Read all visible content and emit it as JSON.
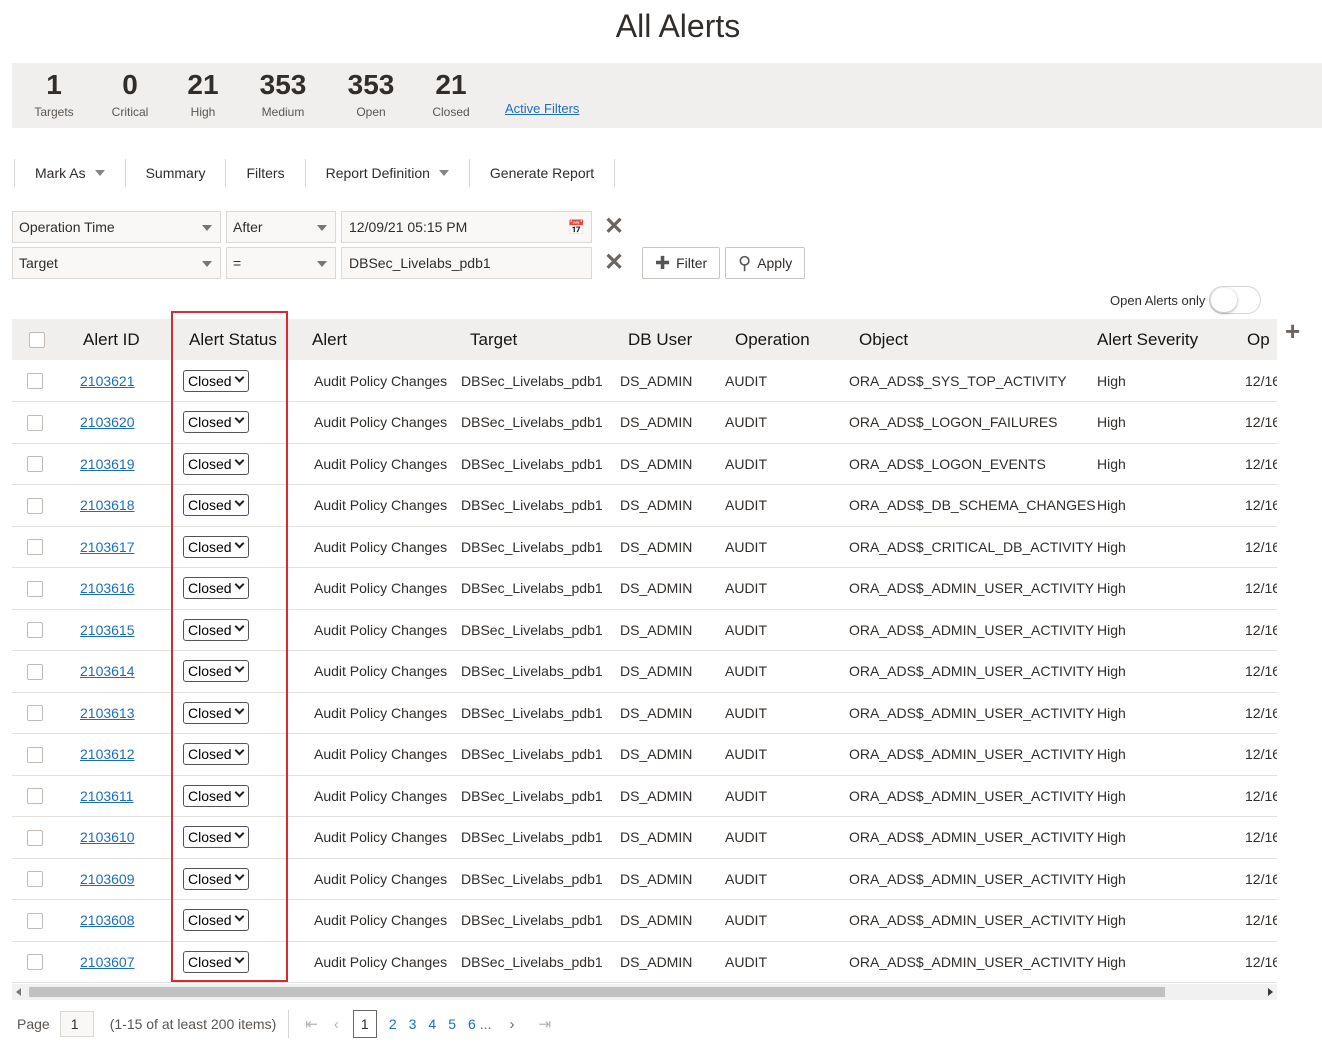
{
  "page": {
    "title": "All Alerts"
  },
  "stats": [
    {
      "value": "1",
      "label": "Targets"
    },
    {
      "value": "0",
      "label": "Critical"
    },
    {
      "value": "21",
      "label": "High"
    },
    {
      "value": "353",
      "label": "Medium"
    },
    {
      "value": "353",
      "label": "Open"
    },
    {
      "value": "21",
      "label": "Closed"
    }
  ],
  "active_filters": "Active Filters",
  "toolbar": {
    "mark_as": "Mark As",
    "summary": "Summary",
    "filters": "Filters",
    "report_definition": "Report Definition",
    "generate_report": "Generate Report"
  },
  "filters": [
    {
      "field": "Operation Time",
      "operator": "After",
      "value": "12/09/21 05:15 PM"
    },
    {
      "field": "Target",
      "operator": "=",
      "value": "DBSec_Livelabs_pdb1"
    }
  ],
  "buttons": {
    "filter": "Filter",
    "apply": "Apply"
  },
  "open_alerts_only": "Open Alerts only",
  "table": {
    "headers": [
      "Alert ID",
      "Alert Status",
      "Alert",
      "Target",
      "DB User",
      "Operation",
      "Object",
      "Alert Severity",
      "Op"
    ],
    "rows": [
      {
        "id": "2103621",
        "status": "Closed",
        "alert": "Audit Policy Changes",
        "target": "DBSec_Livelabs_pdb1",
        "db_user": "DS_ADMIN",
        "operation": "AUDIT",
        "object": "ORA_ADS$_SYS_TOP_ACTIVITY",
        "severity": "High",
        "op_time": "12/16/"
      },
      {
        "id": "2103620",
        "status": "Closed",
        "alert": "Audit Policy Changes",
        "target": "DBSec_Livelabs_pdb1",
        "db_user": "DS_ADMIN",
        "operation": "AUDIT",
        "object": "ORA_ADS$_LOGON_FAILURES",
        "severity": "High",
        "op_time": "12/16/"
      },
      {
        "id": "2103619",
        "status": "Closed",
        "alert": "Audit Policy Changes",
        "target": "DBSec_Livelabs_pdb1",
        "db_user": "DS_ADMIN",
        "operation": "AUDIT",
        "object": "ORA_ADS$_LOGON_EVENTS",
        "severity": "High",
        "op_time": "12/16/"
      },
      {
        "id": "2103618",
        "status": "Closed",
        "alert": "Audit Policy Changes",
        "target": "DBSec_Livelabs_pdb1",
        "db_user": "DS_ADMIN",
        "operation": "AUDIT",
        "object": "ORA_ADS$_DB_SCHEMA_CHANGES",
        "severity": "High",
        "op_time": "12/16/"
      },
      {
        "id": "2103617",
        "status": "Closed",
        "alert": "Audit Policy Changes",
        "target": "DBSec_Livelabs_pdb1",
        "db_user": "DS_ADMIN",
        "operation": "AUDIT",
        "object": "ORA_ADS$_CRITICAL_DB_ACTIVITY",
        "severity": "High",
        "op_time": "12/16/"
      },
      {
        "id": "2103616",
        "status": "Closed",
        "alert": "Audit Policy Changes",
        "target": "DBSec_Livelabs_pdb1",
        "db_user": "DS_ADMIN",
        "operation": "AUDIT",
        "object": "ORA_ADS$_ADMIN_USER_ACTIVITY",
        "severity": "High",
        "op_time": "12/16/"
      },
      {
        "id": "2103615",
        "status": "Closed",
        "alert": "Audit Policy Changes",
        "target": "DBSec_Livelabs_pdb1",
        "db_user": "DS_ADMIN",
        "operation": "AUDIT",
        "object": "ORA_ADS$_ADMIN_USER_ACTIVITY",
        "severity": "High",
        "op_time": "12/16/"
      },
      {
        "id": "2103614",
        "status": "Closed",
        "alert": "Audit Policy Changes",
        "target": "DBSec_Livelabs_pdb1",
        "db_user": "DS_ADMIN",
        "operation": "AUDIT",
        "object": "ORA_ADS$_ADMIN_USER_ACTIVITY",
        "severity": "High",
        "op_time": "12/16/"
      },
      {
        "id": "2103613",
        "status": "Closed",
        "alert": "Audit Policy Changes",
        "target": "DBSec_Livelabs_pdb1",
        "db_user": "DS_ADMIN",
        "operation": "AUDIT",
        "object": "ORA_ADS$_ADMIN_USER_ACTIVITY",
        "severity": "High",
        "op_time": "12/16/"
      },
      {
        "id": "2103612",
        "status": "Closed",
        "alert": "Audit Policy Changes",
        "target": "DBSec_Livelabs_pdb1",
        "db_user": "DS_ADMIN",
        "operation": "AUDIT",
        "object": "ORA_ADS$_ADMIN_USER_ACTIVITY",
        "severity": "High",
        "op_time": "12/16/"
      },
      {
        "id": "2103611",
        "status": "Closed",
        "alert": "Audit Policy Changes",
        "target": "DBSec_Livelabs_pdb1",
        "db_user": "DS_ADMIN",
        "operation": "AUDIT",
        "object": "ORA_ADS$_ADMIN_USER_ACTIVITY",
        "severity": "High",
        "op_time": "12/16/"
      },
      {
        "id": "2103610",
        "status": "Closed",
        "alert": "Audit Policy Changes",
        "target": "DBSec_Livelabs_pdb1",
        "db_user": "DS_ADMIN",
        "operation": "AUDIT",
        "object": "ORA_ADS$_ADMIN_USER_ACTIVITY",
        "severity": "High",
        "op_time": "12/16/"
      },
      {
        "id": "2103609",
        "status": "Closed",
        "alert": "Audit Policy Changes",
        "target": "DBSec_Livelabs_pdb1",
        "db_user": "DS_ADMIN",
        "operation": "AUDIT",
        "object": "ORA_ADS$_ADMIN_USER_ACTIVITY",
        "severity": "High",
        "op_time": "12/16/"
      },
      {
        "id": "2103608",
        "status": "Closed",
        "alert": "Audit Policy Changes",
        "target": "DBSec_Livelabs_pdb1",
        "db_user": "DS_ADMIN",
        "operation": "AUDIT",
        "object": "ORA_ADS$_ADMIN_USER_ACTIVITY",
        "severity": "High",
        "op_time": "12/16/"
      },
      {
        "id": "2103607",
        "status": "Closed",
        "alert": "Audit Policy Changes",
        "target": "DBSec_Livelabs_pdb1",
        "db_user": "DS_ADMIN",
        "operation": "AUDIT",
        "object": "ORA_ADS$_ADMIN_USER_ACTIVITY",
        "severity": "High",
        "op_time": "12/16/"
      }
    ]
  },
  "pagination": {
    "page_label": "Page",
    "page_value": "1",
    "info": "(1-15 of at least 200 items)",
    "pages": [
      "1",
      "2",
      "3",
      "4",
      "5",
      "6"
    ],
    "ellipsis": "..."
  },
  "colors": {
    "accent_link": "#1b6ec2",
    "highlight_border": "#e0262f",
    "header_bg": "#f1efed"
  }
}
